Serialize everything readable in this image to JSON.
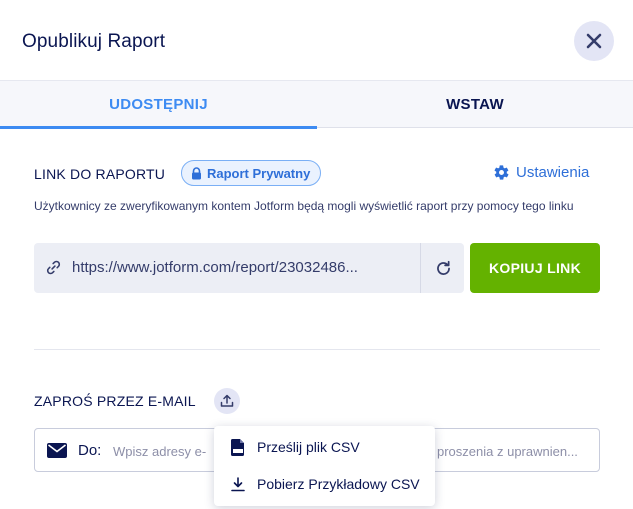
{
  "header": {
    "title": "Opublikuj Raport"
  },
  "tabs": [
    {
      "label": "UDOSTĘPNIJ",
      "active": true
    },
    {
      "label": "WSTAW",
      "active": false
    }
  ],
  "link_section": {
    "label": "LINK DO RAPORTU",
    "badge": "Raport Prywatny",
    "settings": "Ustawienia",
    "description": "Użytkownicy ze zweryfikowanym kontem Jotform będą mogli wyświetlić raport przy pomocy tego linku",
    "url": "https://www.jotform.com/report/23032486...",
    "copy_label": "KOPIUJ LINK"
  },
  "email_section": {
    "label": "ZAPROŚ PRZEZ E-MAIL",
    "to_label": "Do:",
    "placeholder_start": "Wpisz adresy e-",
    "placeholder_end": "proszenia z uprawnien...",
    "dropdown": [
      {
        "label": "Prześlij plik CSV",
        "icon": "csv-file-icon"
      },
      {
        "label": "Pobierz Przykładowy CSV",
        "icon": "download-icon"
      }
    ]
  },
  "colors": {
    "accent": "#3d8bf2",
    "copy_button": "#64b200",
    "text": "#0a1551"
  }
}
